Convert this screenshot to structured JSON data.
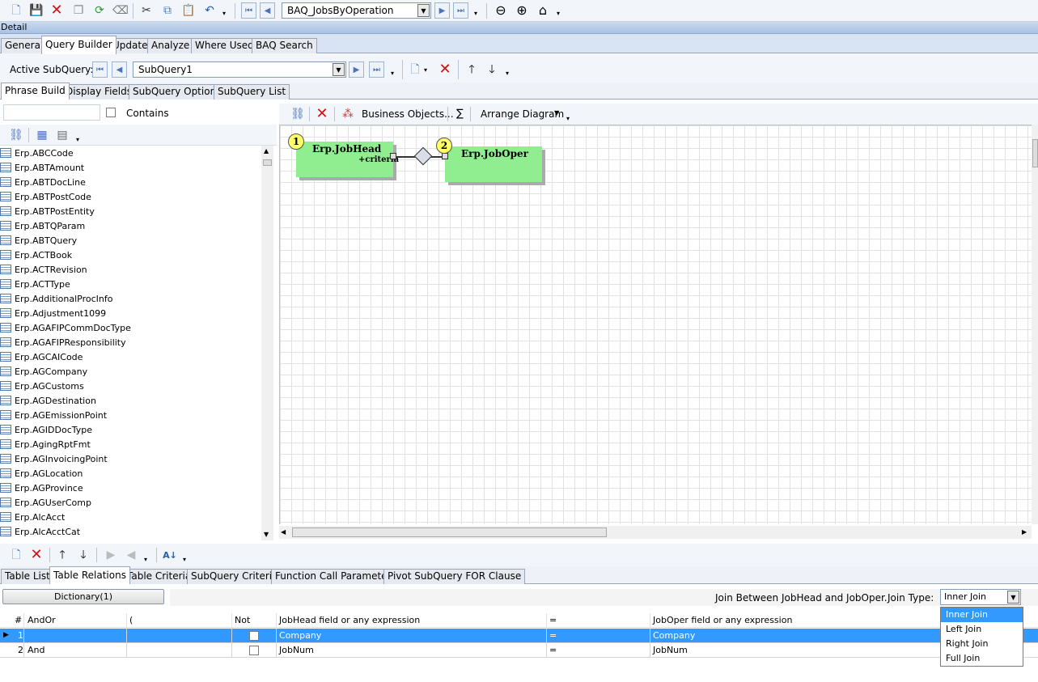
{
  "toolbar": {
    "query_name": "BAQ_JobsByOperation"
  },
  "section": {
    "title": "Detail"
  },
  "main_tabs": [
    "General",
    "Query Builder",
    "Update",
    "Analyze",
    "Where Used",
    "BAQ Search"
  ],
  "subquery_bar": {
    "label": "Active SubQuery:",
    "value": "SubQuery1"
  },
  "sub_tabs": [
    "Phrase Build",
    "Display Fields",
    "SubQuery Options",
    "SubQuery List"
  ],
  "left_panel": {
    "search_value": "",
    "contains_label": "Contains",
    "tables": [
      "Erp.ABCCode",
      "Erp.ABTAmount",
      "Erp.ABTDocLine",
      "Erp.ABTPostCode",
      "Erp.ABTPostEntity",
      "Erp.ABTQParam",
      "Erp.ABTQuery",
      "Erp.ACTBook",
      "Erp.ACTRevision",
      "Erp.ACTType",
      "Erp.AdditionalProcInfo",
      "Erp.Adjustment1099",
      "Erp.AGAFIPCommDocType",
      "Erp.AGAFIPResponsibility",
      "Erp.AGCAICode",
      "Erp.AGCompany",
      "Erp.AGCustoms",
      "Erp.AGDestination",
      "Erp.AGEmissionPoint",
      "Erp.AGIDDocType",
      "Erp.AgingRptFmt",
      "Erp.AGInvoicingPoint",
      "Erp.AGLocation",
      "Erp.AGProvince",
      "Erp.AGUserComp",
      "Erp.AlcAcct",
      "Erp.AlcAcctCat"
    ]
  },
  "diagram_toolbar": {
    "business_objects": "Business Objects...",
    "sigma": "∑",
    "arrange": "Arrange Diagram"
  },
  "diagram": {
    "node1": {
      "num": "1",
      "name": "Erp.JobHead",
      "sub": "+criteria"
    },
    "node2": {
      "num": "2",
      "name": "Erp.JobOper"
    }
  },
  "bottom_tabs": [
    "Table List",
    "Table Relations",
    "Table Criteria",
    "SubQuery Criteria",
    "Function Call Parameters",
    "Pivot SubQuery FOR Clause"
  ],
  "relations": {
    "dictionary_button": "Dictionary(1)",
    "join_label": "Join Between JobHead and JobOper.",
    "join_type_label": "Join Type:",
    "join_type_value": "Inner Join",
    "join_options": [
      "Inner Join",
      "Left Join",
      "Right Join",
      "Full Join"
    ],
    "columns": [
      "#",
      "AndOr",
      "(",
      "Not",
      "JobHead field or any expression",
      "=",
      "JobOper field or any expression"
    ],
    "rows": [
      {
        "num": "1",
        "andor": "",
        "paren": "",
        "left": "Company",
        "op": "=",
        "right": "Company"
      },
      {
        "num": "2",
        "andor": "And",
        "paren": "",
        "left": "JobNum",
        "op": "=",
        "right": "JobNum"
      }
    ]
  },
  "colors": {
    "accent": "#3399ff",
    "node": "#90ee90",
    "circle": "#ffff66",
    "tab_bar": "#d8e4f4"
  }
}
